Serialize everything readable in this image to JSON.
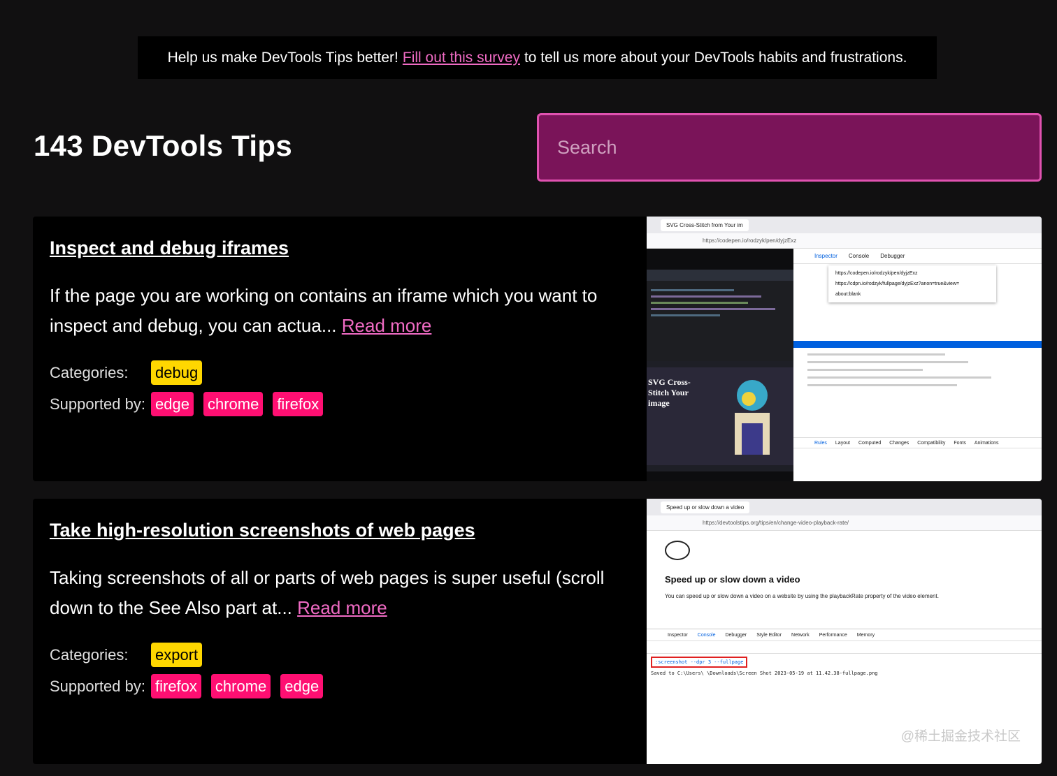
{
  "banner": {
    "text_before": "Help us make DevTools Tips better!",
    "link": "Fill out this survey",
    "text_after": "to tell us more about your DevTools habits and frustrations."
  },
  "header": {
    "title": "143 DevTools Tips",
    "search_placeholder": "Search"
  },
  "labels": {
    "categories": "Categories:",
    "supported_by": "Supported by:",
    "read_more": "Read more"
  },
  "tips": [
    {
      "title": "Inspect and debug iframes",
      "description": "If the page you are working on contains an iframe which you want to inspect and debug, you can actua...",
      "categories": [
        "debug"
      ],
      "browsers": [
        "edge",
        "chrome",
        "firefox"
      ],
      "screenshot": {
        "tab": "SVG Cross-Stitch from Your im",
        "url": "https://codepen.io/rodzyk/pen/dyjzExz",
        "devtools_tabs": [
          "Inspector",
          "Console",
          "Debugger"
        ],
        "menu_items": [
          "https://codepen.io/rodzyk/pen/dyjzExz",
          "https://cdpn.io/rodzyk/fullpage/dyjzExz?anon=true&view=",
          "about:blank"
        ],
        "panel_tabs": [
          "Rules",
          "Layout",
          "Computed",
          "Changes",
          "Compatibility",
          "Fonts",
          "Animations"
        ],
        "art_title": "SVG Cross-Stitch Your image"
      }
    },
    {
      "title": "Take high-resolution screenshots of web pages",
      "description": "Taking screenshots of all or parts of web pages is super useful (scroll down to the See Also part at...",
      "categories": [
        "export"
      ],
      "browsers": [
        "firefox",
        "chrome",
        "edge"
      ],
      "screenshot": {
        "tab": "Speed up or slow down a video",
        "url": "https://devtoolstips.org/tips/en/change-video-playback-rate/",
        "heading": "Speed up or slow down a video",
        "body": "You can speed up or slow down a video on a website by using the playbackRate property of the video element.",
        "devtools_tabs": [
          "Inspector",
          "Console",
          "Debugger",
          "Style Editor",
          "Network",
          "Performance",
          "Memory"
        ],
        "command": ":screenshot --dpr 3 --fullpage",
        "output": "Saved to C:\\Users\\                \\Downloads\\Screen Shot 2023-05-19 at 11.42.38-fullpage.png"
      }
    }
  ],
  "watermark": "@稀土掘金技术社区"
}
